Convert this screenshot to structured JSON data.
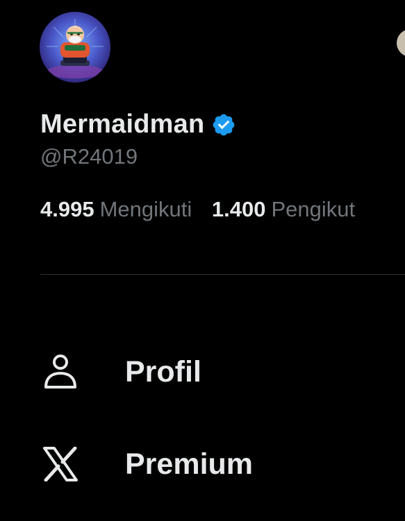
{
  "profile": {
    "display_name": "Mermaidman",
    "handle": "@R24019",
    "verified": true,
    "avatar_icon": "cartoon-character-avatar"
  },
  "stats": {
    "following_count": "4.995",
    "following_label": "Mengikuti",
    "followers_count": "1.400",
    "followers_label": "Pengikut"
  },
  "menu": {
    "items": [
      {
        "label": "Profil",
        "icon": "person-icon"
      },
      {
        "label": "Premium",
        "icon": "x-logo-icon"
      }
    ]
  },
  "colors": {
    "background": "#000000",
    "primary_text": "#e7e9ea",
    "secondary_text": "#71767b",
    "verified_badge": "#1d9bf0",
    "divider": "#2f3336"
  }
}
